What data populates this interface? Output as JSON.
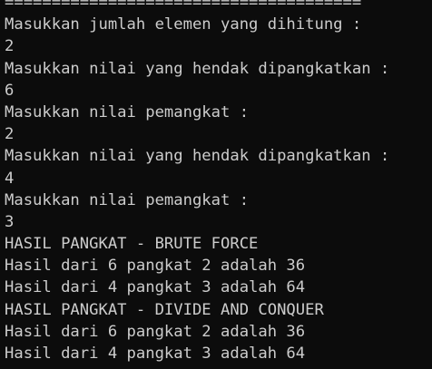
{
  "terminal": {
    "lines": [
      "======================================",
      "Masukkan jumlah elemen yang dihitung :",
      "2",
      "Masukkan nilai yang hendak dipangkatkan :",
      "6",
      "Masukkan nilai pemangkat :",
      "2",
      "Masukkan nilai yang hendak dipangkatkan :",
      "4",
      "Masukkan nilai pemangkat :",
      "3",
      "HASIL PANGKAT - BRUTE FORCE",
      "Hasil dari 6 pangkat 2 adalah 36",
      "Hasil dari 4 pangkat 3 adalah 64",
      "HASIL PANGKAT - DIVIDE AND CONQUER",
      "Hasil dari 6 pangkat 2 adalah 36",
      "Hasil dari 4 pangkat 3 adalah 64"
    ]
  }
}
